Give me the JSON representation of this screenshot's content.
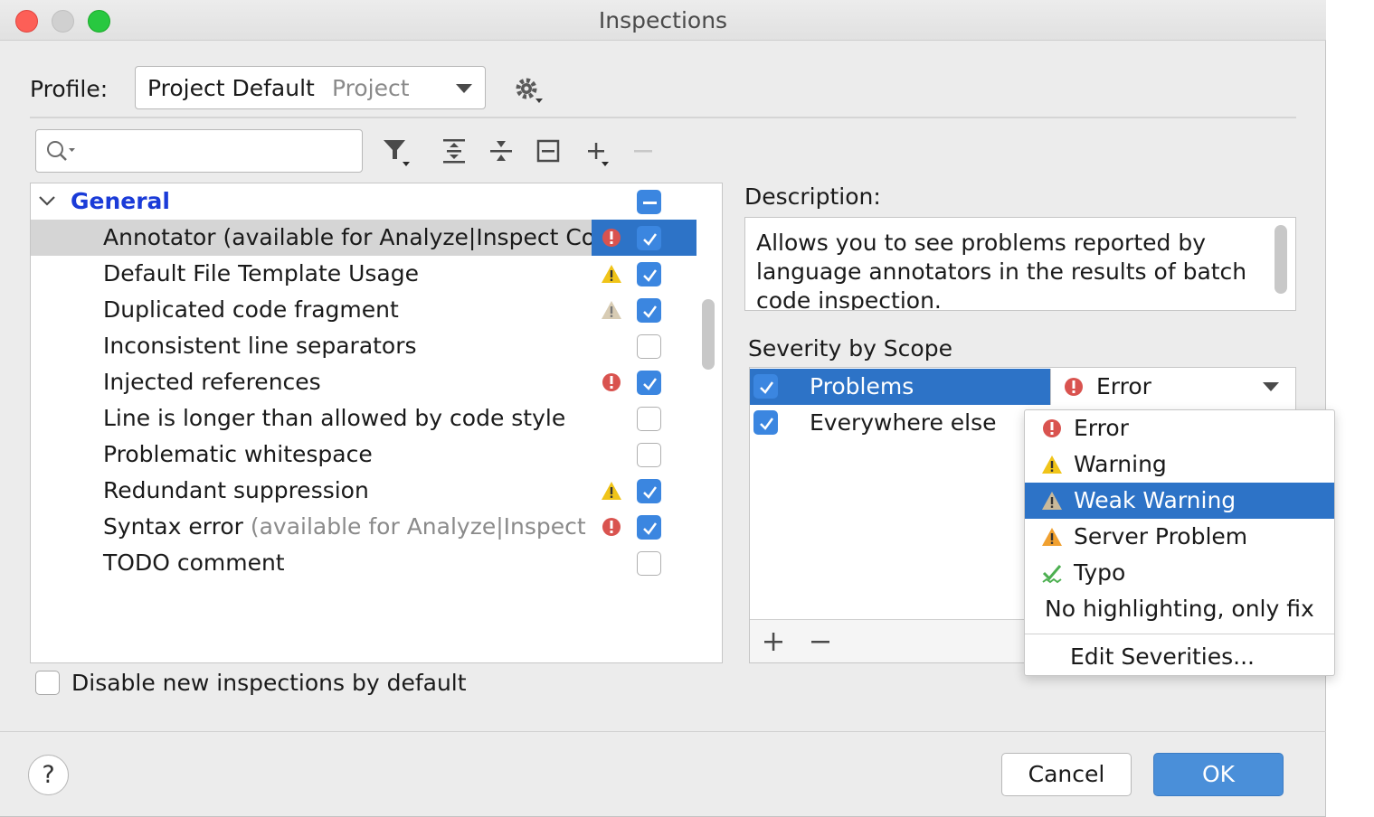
{
  "window": {
    "title": "Inspections"
  },
  "profile": {
    "label": "Profile:",
    "value": "Project Default",
    "scope": "Project"
  },
  "tree": {
    "group": "General",
    "rows": [
      {
        "label": "Annotator (available for Analyze|Inspect Co",
        "label_gray": "",
        "severity": "error",
        "checked": true,
        "selected": true
      },
      {
        "label": "Default File Template Usage",
        "label_gray": "",
        "severity": "warning",
        "checked": true,
        "selected": false
      },
      {
        "label": "Duplicated code fragment",
        "label_gray": "",
        "severity": "weak-warning",
        "checked": true,
        "selected": false
      },
      {
        "label": "Inconsistent line separators",
        "label_gray": "",
        "severity": "none",
        "checked": false,
        "selected": false
      },
      {
        "label": "Injected references",
        "label_gray": "",
        "severity": "error",
        "checked": true,
        "selected": false
      },
      {
        "label": "Line is longer than allowed by code style",
        "label_gray": "",
        "severity": "none",
        "checked": false,
        "selected": false
      },
      {
        "label": "Problematic whitespace",
        "label_gray": "",
        "severity": "none",
        "checked": false,
        "selected": false
      },
      {
        "label": "Redundant suppression",
        "label_gray": "",
        "severity": "warning",
        "checked": true,
        "selected": false
      },
      {
        "label": "Syntax error ",
        "label_gray": "(available for Analyze|Inspect",
        "severity": "error",
        "checked": true,
        "selected": false
      },
      {
        "label": "TODO comment",
        "label_gray": "",
        "severity": "none",
        "checked": false,
        "selected": false
      }
    ]
  },
  "disable_new": {
    "label": "Disable new inspections by default",
    "checked": false
  },
  "description": {
    "label": "Description:",
    "text": "Allows you to see problems reported by language annotators in the results of batch code inspection."
  },
  "severity_scope": {
    "label": "Severity by Scope",
    "rows": [
      {
        "name": "Problems",
        "checked": true,
        "severity": "Error",
        "selected": true
      },
      {
        "name": "Everywhere else",
        "checked": true,
        "severity": "",
        "selected": false
      }
    ]
  },
  "severity_popup": {
    "items": [
      {
        "label": "Error",
        "icon": "error-icon",
        "selected": false
      },
      {
        "label": "Warning",
        "icon": "warning-icon",
        "selected": false
      },
      {
        "label": "Weak Warning",
        "icon": "weak-warning-icon",
        "selected": true
      },
      {
        "label": "Server Problem",
        "icon": "server-problem-icon",
        "selected": false
      },
      {
        "label": "Typo",
        "icon": "typo-icon",
        "selected": false
      },
      {
        "label": "No highlighting, only fix",
        "icon": "",
        "selected": false
      }
    ],
    "edit_label": "Edit Severities..."
  },
  "buttons": {
    "help": "?",
    "cancel": "Cancel",
    "ok": "OK"
  },
  "colors": {
    "accent": "#2d73c7",
    "error": "#d9534f",
    "warning": "#f0c419",
    "weak_warning": "#c9b99a",
    "server": "#f0a030",
    "typo": "#4caf50"
  }
}
